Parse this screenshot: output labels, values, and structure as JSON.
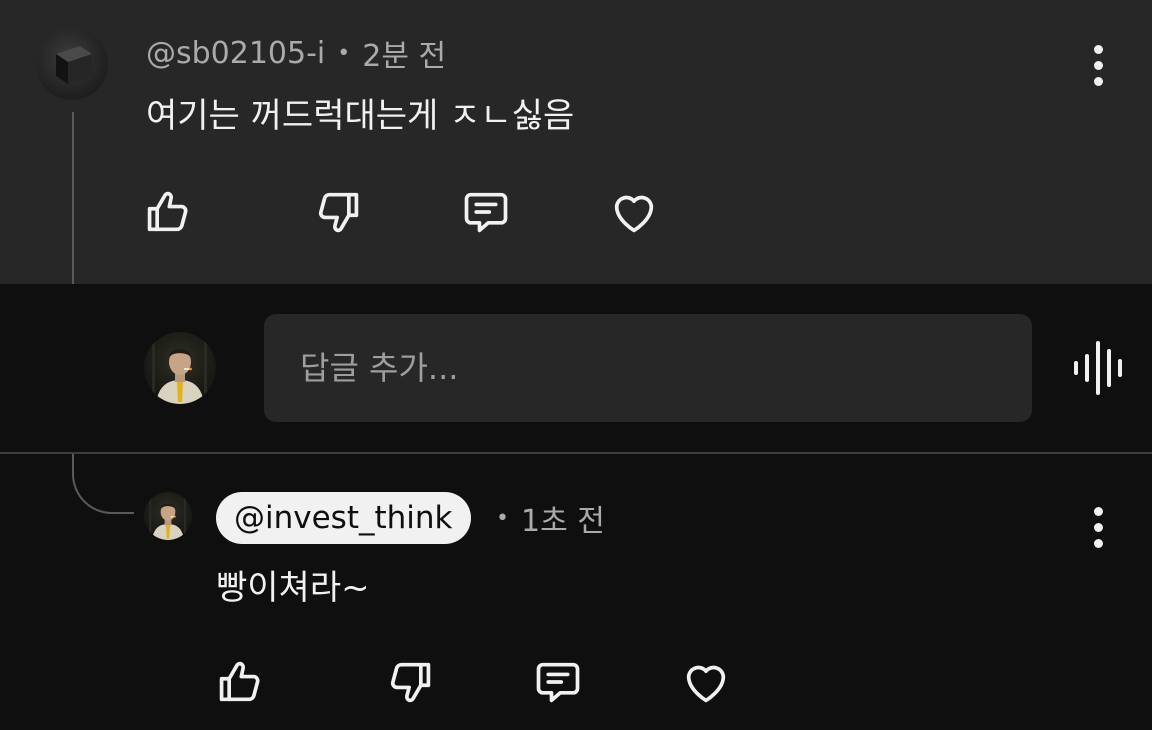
{
  "top_comment": {
    "handle": "@sb02105-i",
    "separator": "•",
    "time": "2분 전",
    "text": "여기는 꺼드럭대는게 ㅈㄴ싫음"
  },
  "reply_box": {
    "placeholder": "답글 추가..."
  },
  "reply": {
    "mention": "@invest_think",
    "separator": "•",
    "time": "1초 전",
    "text": "빵이쳐라~"
  },
  "icons": {
    "like": "thumbs-up-icon",
    "dislike": "thumbs-down-icon",
    "reply": "comment-icon",
    "heart": "heart-icon",
    "more": "more-vertical-icon",
    "voice": "voice-search-icon"
  },
  "colors": {
    "background": "#0f0f0f",
    "comment_panel": "#272727",
    "text": "#f1f1f1",
    "secondary_text": "#aaaaaa",
    "mention_chip": "#f1f1f1",
    "tie_accent": "#e3b21a"
  }
}
